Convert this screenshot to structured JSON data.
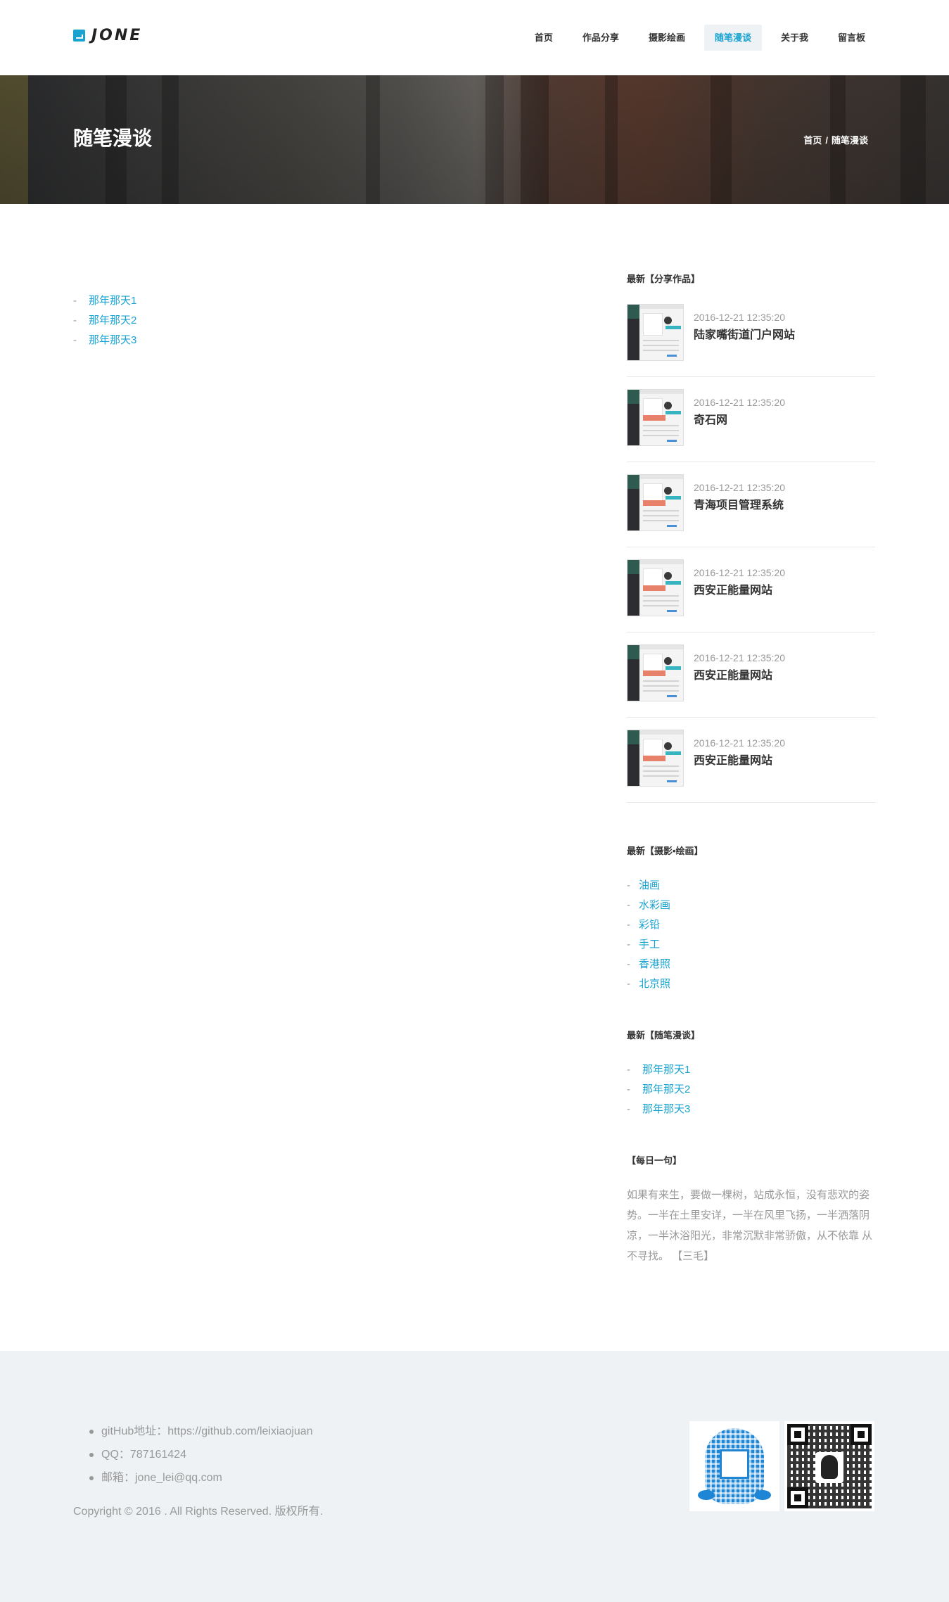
{
  "brand": {
    "name": "JONE",
    "accent": "#19a3d1"
  },
  "nav": {
    "items": [
      {
        "label": "首页"
      },
      {
        "label": "作品分享"
      },
      {
        "label": "摄影绘画"
      },
      {
        "label": "随笔漫谈",
        "active": true
      },
      {
        "label": "关于我"
      },
      {
        "label": "留言板"
      }
    ]
  },
  "banner": {
    "title": "随笔漫谈",
    "breadcrumb": {
      "home": "首页",
      "separator": "/",
      "current": "随笔漫谈"
    }
  },
  "essays": {
    "dash": "-",
    "items": [
      "那年那天1",
      "那年那天2",
      "那年那天3"
    ]
  },
  "sidebar": {
    "works": {
      "title": "最新【分享作品】",
      "items": [
        {
          "date": "2016-12-21 12:35:20",
          "name": "陆家嘴街道门户网站"
        },
        {
          "date": "2016-12-21 12:35:20",
          "name": "奇石网"
        },
        {
          "date": "2016-12-21 12:35:20",
          "name": "青海项目管理系统"
        },
        {
          "date": "2016-12-21 12:35:20",
          "name": "西安正能量网站"
        },
        {
          "date": "2016-12-21 12:35:20",
          "name": "西安正能量网站"
        },
        {
          "date": "2016-12-21 12:35:20",
          "name": "西安正能量网站"
        }
      ]
    },
    "art": {
      "title": "最新【摄影•绘画】",
      "items": [
        "油画",
        "水彩画",
        "彩铅",
        "手工",
        "香港照",
        "北京照"
      ]
    },
    "essays": {
      "title": "最新【随笔漫谈】",
      "items": [
        "那年那天1",
        "那年那天2",
        "那年那天3"
      ]
    },
    "quote": {
      "title": "【每日一句】",
      "text": "如果有来生，要做一棵树，站成永恒，没有悲欢的姿势。一半在土里安详，一半在风里飞扬，一半洒落阴凉，一半沐浴阳光，非常沉默非常骄傲，从不依靠 从不寻找。 【三毛】"
    }
  },
  "footer": {
    "contact": [
      "gitHub地址：https://github.com/leixiaojuan",
      "QQ：787161424",
      "邮箱：jone_lei@qq.com"
    ],
    "copyright": "Copyright © 2016 . All Rights Reserved. 版权所有.",
    "qr_qq_icon": "qq-qrcode-icon",
    "qr_wechat_icon": "wechat-qrcode-icon"
  }
}
